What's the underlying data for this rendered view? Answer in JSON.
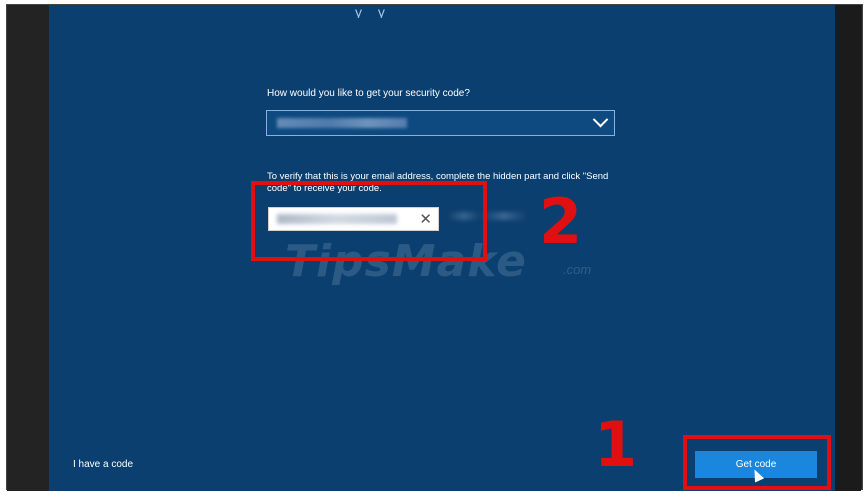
{
  "dialog": {
    "title_fragment": "y y",
    "question": "How would you like to get your security code?",
    "method_select_value": "Email a*****@outlook.com",
    "instructions": "To verify that this is your email address, complete the hidden part and click \"Send code\" to receive your code.",
    "email_input_value": "a*******",
    "email_domain_hint": "@outlook.com",
    "clear_glyph": "✕"
  },
  "annotations": {
    "step_2": "2",
    "step_1": "1"
  },
  "watermark": {
    "text": "TipsMake",
    "suffix": ".com"
  },
  "footer": {
    "have_code_link": "I have a code",
    "get_code_button": "Get code"
  },
  "colors": {
    "panel": "#0b3f6f",
    "button": "#1a86de",
    "annotation": "#e01010"
  },
  "icons": [
    "chevron-down-icon",
    "close-icon",
    "mouse-cursor-icon"
  ]
}
